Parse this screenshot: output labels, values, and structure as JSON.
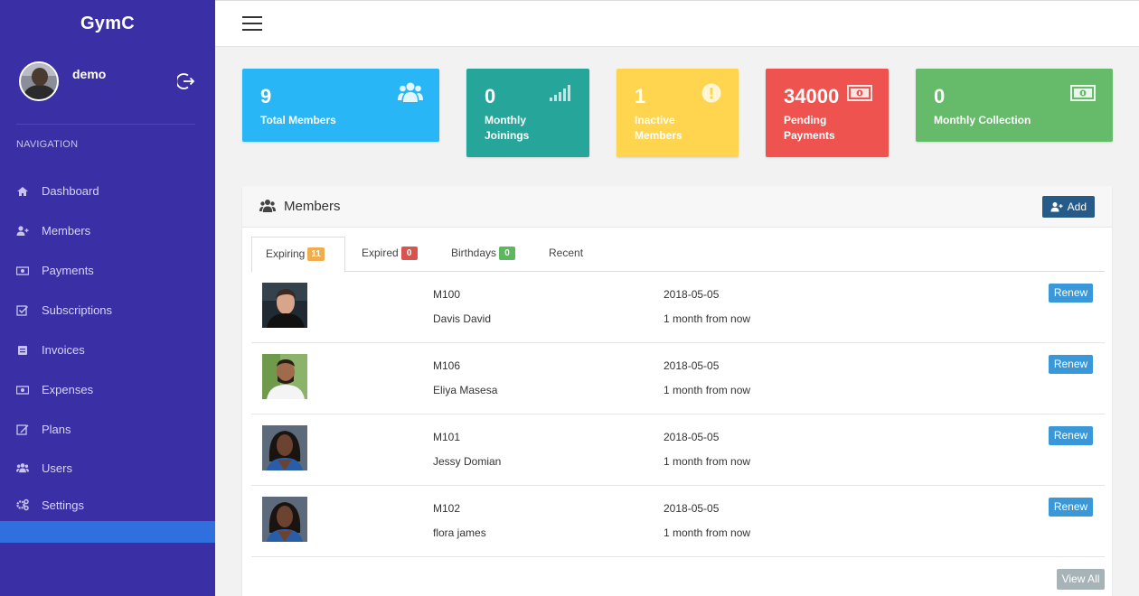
{
  "app": {
    "brand": "GymC"
  },
  "user": {
    "name": "demo"
  },
  "nav": {
    "title": "NAVIGATION",
    "items": [
      {
        "label": "Dashboard",
        "icon": "home-icon"
      },
      {
        "label": "Members",
        "icon": "add-user-icon"
      },
      {
        "label": "Payments",
        "icon": "money-icon"
      },
      {
        "label": "Subscriptions",
        "icon": "check-square-icon"
      },
      {
        "label": "Invoices",
        "icon": "invoice-icon"
      },
      {
        "label": "Expenses",
        "icon": "money-icon"
      },
      {
        "label": "Plans",
        "icon": "edit-icon"
      },
      {
        "label": "Users",
        "icon": "users-icon"
      },
      {
        "label": "Settings",
        "icon": "cogs-icon"
      }
    ]
  },
  "stats": [
    {
      "value": "9",
      "label": "Total Members",
      "color": "#29b6f6",
      "icon": "users-icon"
    },
    {
      "value": "0",
      "label_line1": "Monthly",
      "label_line2": "Joinings",
      "color": "#26a69a",
      "icon": "signal-icon"
    },
    {
      "value": "1",
      "label_line1": "Inactive",
      "label_line2": "Members",
      "color": "#ffd54f",
      "icon": "exclamation-icon"
    },
    {
      "value": "34000",
      "label_line1": "Pending",
      "label_line2": "Payments",
      "color": "#ef5350",
      "icon": "money-icon"
    },
    {
      "value": "0",
      "label": "Monthly Collection",
      "color": "#66bb6a",
      "icon": "money-icon"
    }
  ],
  "members_panel": {
    "title": "Members",
    "add_label": "Add",
    "tabs": [
      {
        "label": "Expiring",
        "badge": "11",
        "badge_color": "#f0ad4e"
      },
      {
        "label": "Expired",
        "badge": "0",
        "badge_color": "#d9534f"
      },
      {
        "label": "Birthdays",
        "badge": "0",
        "badge_color": "#5cb85c"
      },
      {
        "label": "Recent"
      }
    ],
    "rows": [
      {
        "code": "M100",
        "name": "Davis David",
        "date": "2018-05-05",
        "relative": "1 month from now",
        "action": "Renew"
      },
      {
        "code": "M106",
        "name": "Eliya Masesa",
        "date": "2018-05-05",
        "relative": "1 month from now",
        "action": "Renew"
      },
      {
        "code": "M101",
        "name": "Jessy Domian",
        "date": "2018-05-05",
        "relative": "1 month from now",
        "action": "Renew"
      },
      {
        "code": "M102",
        "name": "flora james",
        "date": "2018-05-05",
        "relative": "1 month from now",
        "action": "Renew"
      }
    ],
    "view_all_label": "View All"
  }
}
